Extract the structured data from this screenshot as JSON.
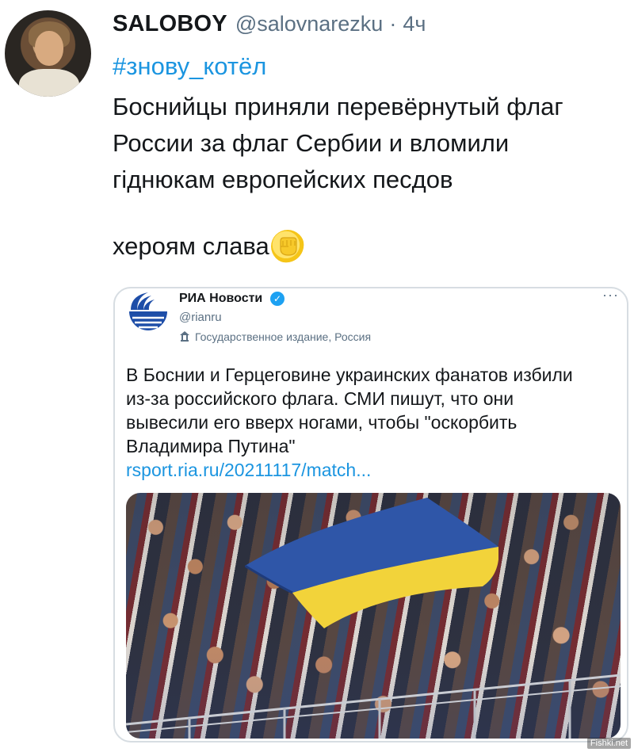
{
  "tweet": {
    "display_name": "SALOBOY",
    "handle": "@salovnarezku",
    "separator": "·",
    "time": "4ч",
    "hashtag": "#знову_котёл",
    "text_lines": [
      "Боснийцы приняли перевёрнутый флаг",
      "России за флаг Сербии и вломили",
      "гіднюкам европейских песдов"
    ],
    "closing": "хероям слава",
    "closing_emoji": "fist-emoji"
  },
  "quoted_tweet": {
    "display_name": "РИА Новости",
    "verified": true,
    "handle": "@rianru",
    "account_label": "Государственное издание, Россия",
    "more": "···",
    "text_lines": [
      "В Боснии и Герцеговине украинских фанатов избили",
      "из-за российского флага. СМИ пишут, что они",
      "вывесили его вверх ногами, чтобы \"оскорбить",
      "Владимира Путина\""
    ],
    "link": "rsport.ria.ru/20211117/match...",
    "image_desc": "stadium-crowd-with-ukrainian-flag"
  },
  "watermark": "Fishki.net",
  "colors": {
    "link": "#1b95e0",
    "muted": "#5b7083",
    "flag_blue": "#2f56a8",
    "flag_yellow": "#f2d33a",
    "ria_blue": "#1e4ea8"
  }
}
